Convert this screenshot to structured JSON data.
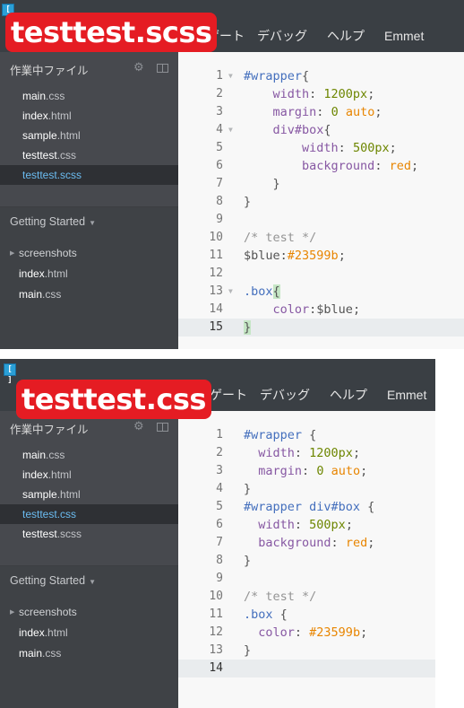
{
  "top": {
    "title_overlay": "testtest.scss",
    "menu": [
      "ゲート",
      "デバッグ",
      "ヘルプ",
      "Emmet"
    ],
    "sidebar": {
      "working_files_header": "作業中ファイル",
      "working_files": [
        {
          "name": "main",
          "ext": ".css",
          "active": false
        },
        {
          "name": "index",
          "ext": ".html",
          "active": false
        },
        {
          "name": "sample",
          "ext": ".html",
          "active": false
        },
        {
          "name": "testtest",
          "ext": ".css",
          "active": false
        },
        {
          "name": "testtest",
          "ext": ".scss",
          "active": true
        }
      ],
      "project_title": "Getting Started",
      "tree": [
        {
          "name": "screenshots",
          "ext": "",
          "folder": true
        },
        {
          "name": "index",
          "ext": ".html",
          "folder": false
        },
        {
          "name": "main",
          "ext": ".css",
          "folder": false
        }
      ]
    },
    "editor": {
      "current_line": 15,
      "lines": [
        {
          "n": "1",
          "fold": "▼",
          "tokens": [
            {
              "t": "#wrapper",
              "c": "sel"
            },
            {
              "t": "{",
              "c": "plain"
            }
          ]
        },
        {
          "n": "2",
          "fold": "",
          "tokens": [
            {
              "t": "    ",
              "c": "plain"
            },
            {
              "t": "width",
              "c": "prop"
            },
            {
              "t": ": ",
              "c": "plain"
            },
            {
              "t": "1200px",
              "c": "num"
            },
            {
              "t": ";",
              "c": "plain"
            }
          ]
        },
        {
          "n": "3",
          "fold": "",
          "tokens": [
            {
              "t": "    ",
              "c": "plain"
            },
            {
              "t": "margin",
              "c": "prop"
            },
            {
              "t": ": ",
              "c": "plain"
            },
            {
              "t": "0",
              "c": "num"
            },
            {
              "t": " ",
              "c": "plain"
            },
            {
              "t": "auto",
              "c": "kw"
            },
            {
              "t": ";",
              "c": "plain"
            }
          ]
        },
        {
          "n": "4",
          "fold": "▼",
          "tokens": [
            {
              "t": "    ",
              "c": "plain"
            },
            {
              "t": "div#box",
              "c": "prop"
            },
            {
              "t": "{",
              "c": "plain"
            }
          ]
        },
        {
          "n": "5",
          "fold": "",
          "tokens": [
            {
              "t": "        ",
              "c": "plain"
            },
            {
              "t": "width",
              "c": "prop"
            },
            {
              "t": ": ",
              "c": "plain"
            },
            {
              "t": "500px",
              "c": "num"
            },
            {
              "t": ";",
              "c": "plain"
            }
          ]
        },
        {
          "n": "6",
          "fold": "",
          "tokens": [
            {
              "t": "        ",
              "c": "plain"
            },
            {
              "t": "background",
              "c": "prop"
            },
            {
              "t": ": ",
              "c": "plain"
            },
            {
              "t": "red",
              "c": "kw"
            },
            {
              "t": ";",
              "c": "plain"
            }
          ]
        },
        {
          "n": "7",
          "fold": "",
          "tokens": [
            {
              "t": "    }",
              "c": "plain"
            }
          ]
        },
        {
          "n": "8",
          "fold": "",
          "tokens": [
            {
              "t": "}",
              "c": "plain"
            }
          ]
        },
        {
          "n": "9",
          "fold": "",
          "tokens": []
        },
        {
          "n": "10",
          "fold": "",
          "tokens": [
            {
              "t": "/* test */",
              "c": "com"
            }
          ]
        },
        {
          "n": "11",
          "fold": "",
          "tokens": [
            {
              "t": "$blue",
              "c": "var"
            },
            {
              "t": ":",
              "c": "plain"
            },
            {
              "t": "#23599b",
              "c": "str"
            },
            {
              "t": ";",
              "c": "plain"
            }
          ]
        },
        {
          "n": "12",
          "fold": "",
          "tokens": []
        },
        {
          "n": "13",
          "fold": "▼",
          "tokens": [
            {
              "t": ".box",
              "c": "sel"
            },
            {
              "t": "{",
              "c": "brace-hl"
            }
          ]
        },
        {
          "n": "14",
          "fold": "",
          "tokens": [
            {
              "t": "    ",
              "c": "plain"
            },
            {
              "t": "color",
              "c": "prop"
            },
            {
              "t": ":",
              "c": "plain"
            },
            {
              "t": "$blue",
              "c": "var"
            },
            {
              "t": ";",
              "c": "plain"
            }
          ]
        },
        {
          "n": "15",
          "fold": "",
          "tokens": [
            {
              "t": "}",
              "c": "brace-hl"
            }
          ]
        }
      ]
    }
  },
  "bottom": {
    "title_overlay": "testtest.css",
    "menu": [
      "ビゲート",
      "デバッグ",
      "ヘルプ",
      "Emmet"
    ],
    "sidebar": {
      "working_files_header": "作業中ファイル",
      "working_files": [
        {
          "name": "main",
          "ext": ".css",
          "active": false
        },
        {
          "name": "index",
          "ext": ".html",
          "active": false
        },
        {
          "name": "sample",
          "ext": ".html",
          "active": false
        },
        {
          "name": "testtest",
          "ext": ".css",
          "active": true
        },
        {
          "name": "testtest",
          "ext": ".scss",
          "active": false
        }
      ],
      "project_title": "Getting Started",
      "tree": [
        {
          "name": "screenshots",
          "ext": "",
          "folder": true
        },
        {
          "name": "index",
          "ext": ".html",
          "folder": false
        },
        {
          "name": "main",
          "ext": ".css",
          "folder": false
        }
      ]
    },
    "editor": {
      "current_line": 14,
      "lines": [
        {
          "n": "1",
          "fold": "",
          "tokens": [
            {
              "t": "#wrapper",
              "c": "sel"
            },
            {
              "t": " {",
              "c": "plain"
            }
          ]
        },
        {
          "n": "2",
          "fold": "",
          "tokens": [
            {
              "t": "  ",
              "c": "plain"
            },
            {
              "t": "width",
              "c": "prop"
            },
            {
              "t": ": ",
              "c": "plain"
            },
            {
              "t": "1200px",
              "c": "num"
            },
            {
              "t": ";",
              "c": "plain"
            }
          ]
        },
        {
          "n": "3",
          "fold": "",
          "tokens": [
            {
              "t": "  ",
              "c": "plain"
            },
            {
              "t": "margin",
              "c": "prop"
            },
            {
              "t": ": ",
              "c": "plain"
            },
            {
              "t": "0",
              "c": "num"
            },
            {
              "t": " ",
              "c": "plain"
            },
            {
              "t": "auto",
              "c": "kw"
            },
            {
              "t": ";",
              "c": "plain"
            }
          ]
        },
        {
          "n": "4",
          "fold": "",
          "tokens": [
            {
              "t": "}",
              "c": "plain"
            }
          ]
        },
        {
          "n": "5",
          "fold": "",
          "tokens": [
            {
              "t": "#wrapper div#box",
              "c": "sel"
            },
            {
              "t": " {",
              "c": "plain"
            }
          ]
        },
        {
          "n": "6",
          "fold": "",
          "tokens": [
            {
              "t": "  ",
              "c": "plain"
            },
            {
              "t": "width",
              "c": "prop"
            },
            {
              "t": ": ",
              "c": "plain"
            },
            {
              "t": "500px",
              "c": "num"
            },
            {
              "t": ";",
              "c": "plain"
            }
          ]
        },
        {
          "n": "7",
          "fold": "",
          "tokens": [
            {
              "t": "  ",
              "c": "plain"
            },
            {
              "t": "background",
              "c": "prop"
            },
            {
              "t": ": ",
              "c": "plain"
            },
            {
              "t": "red",
              "c": "kw"
            },
            {
              "t": ";",
              "c": "plain"
            }
          ]
        },
        {
          "n": "8",
          "fold": "",
          "tokens": [
            {
              "t": "}",
              "c": "plain"
            }
          ]
        },
        {
          "n": "9",
          "fold": "",
          "tokens": []
        },
        {
          "n": "10",
          "fold": "",
          "tokens": [
            {
              "t": "/* test */",
              "c": "com"
            }
          ]
        },
        {
          "n": "11",
          "fold": "",
          "tokens": [
            {
              "t": ".box",
              "c": "sel"
            },
            {
              "t": " {",
              "c": "plain"
            }
          ]
        },
        {
          "n": "12",
          "fold": "",
          "tokens": [
            {
              "t": "  ",
              "c": "plain"
            },
            {
              "t": "color",
              "c": "prop"
            },
            {
              "t": ": ",
              "c": "plain"
            },
            {
              "t": "#23599b",
              "c": "str"
            },
            {
              "t": ";",
              "c": "plain"
            }
          ]
        },
        {
          "n": "13",
          "fold": "",
          "tokens": [
            {
              "t": "}",
              "c": "plain"
            }
          ]
        },
        {
          "n": "14",
          "fold": "",
          "tokens": []
        }
      ]
    }
  },
  "colors": {
    "menubar": "#3a3f44",
    "sidebar": "#47494e",
    "active_file": "#6bbcf1",
    "overlay": "#e51c23",
    "selector": "#446fbd",
    "property": "#8758a3",
    "number": "#6d8600",
    "keyword": "#e88501"
  }
}
